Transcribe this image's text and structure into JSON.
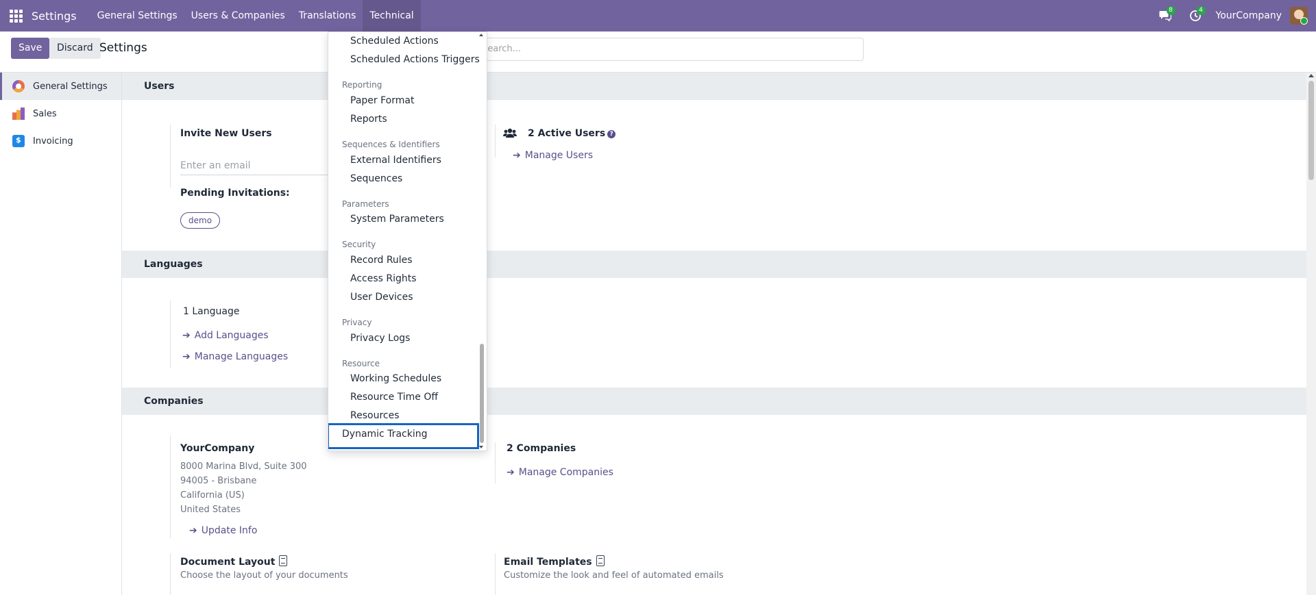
{
  "navbar": {
    "app_title": "Settings",
    "menus": [
      "General Settings",
      "Users & Companies",
      "Translations",
      "Technical"
    ],
    "active_menu": "Technical",
    "messages_count": "8",
    "activities_count": "4",
    "company": "YourCompany"
  },
  "control": {
    "save_label": "Save",
    "discard_label": "Discard",
    "title": "Settings",
    "search_placeholder": "Search..."
  },
  "sidebar": {
    "items": [
      {
        "label": "General Settings",
        "icon": "settings-app-icon"
      },
      {
        "label": "Sales",
        "icon": "sales-app-icon"
      },
      {
        "label": "Invoicing",
        "icon": "invoicing-app-icon"
      }
    ]
  },
  "users": {
    "heading": "Users",
    "invite_label": "Invite New Users",
    "email_placeholder": "Enter an email",
    "pending_label": "Pending Invitations:",
    "pending_user": "demo",
    "active_users": "2 Active Users",
    "manage_users": "Manage Users"
  },
  "languages": {
    "heading": "Languages",
    "count": "1 Language",
    "add": "Add Languages",
    "manage": "Manage Languages"
  },
  "companies": {
    "heading": "Companies",
    "name": "YourCompany",
    "address": [
      "8000 Marina Blvd, Suite 300",
      "94005 - Brisbane",
      "California (US)",
      "United States"
    ],
    "update_info": "Update Info",
    "count": "2 Companies",
    "manage": "Manage Companies",
    "doc_layout_title": "Document Layout",
    "doc_layout_desc": "Choose the layout of your documents",
    "email_templates_title": "Email Templates",
    "email_templates_desc": "Customize the look and feel of automated emails"
  },
  "dropdown": {
    "items": {
      "scheduled_actions": "Scheduled Actions",
      "scheduled_actions_triggers": "Scheduled Actions Triggers",
      "reporting": "Reporting",
      "paper_format": "Paper Format",
      "reports": "Reports",
      "sequences_identifiers": "Sequences & Identifiers",
      "external_identifiers": "External Identifiers",
      "sequences": "Sequences",
      "parameters": "Parameters",
      "system_parameters": "System Parameters",
      "security": "Security",
      "record_rules": "Record Rules",
      "access_rights": "Access Rights",
      "user_devices": "User Devices",
      "privacy": "Privacy",
      "privacy_logs": "Privacy Logs",
      "resource": "Resource",
      "working_schedules": "Working Schedules",
      "resource_time_off": "Resource Time Off",
      "resources": "Resources",
      "dynamic_tracking": "Dynamic Tracking"
    }
  },
  "colors": {
    "brand": "#71639e",
    "link": "#5a4f8a",
    "highlight": "#1565c0"
  }
}
